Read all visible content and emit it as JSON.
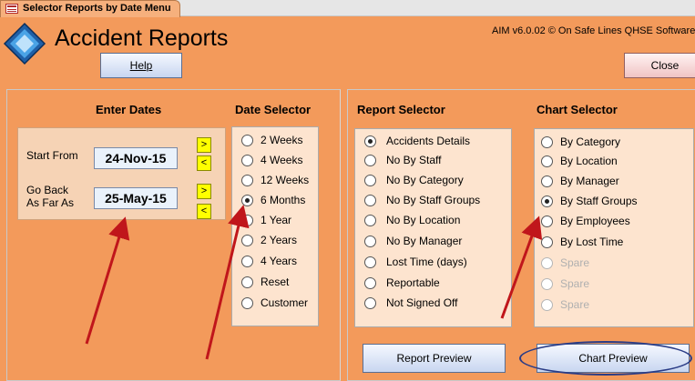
{
  "window": {
    "tab_title": "Selector Reports by Date Menu",
    "icon": "form-icon"
  },
  "header": {
    "title": "Accident Reports",
    "version": "AIM v6.0.02 © On Safe Lines QHSE Software",
    "logo": "diamond-logo"
  },
  "buttons": {
    "help": "Help",
    "close": "Close",
    "report_preview": "Report Preview",
    "chart_preview": "Chart Preview"
  },
  "enter_dates": {
    "heading": "Enter Dates",
    "start_label": "Start From",
    "start_value": "24-Nov-15",
    "back_label_1": "Go Back",
    "back_label_2": "As Far As",
    "back_value": "25-May-15",
    "next_symbol": ">",
    "prev_symbol": "<"
  },
  "date_selector": {
    "heading": "Date Selector",
    "options": [
      "2  Weeks",
      "4  Weeks",
      "12 Weeks",
      "6 Months",
      "1 Year",
      "2 Years",
      "4 Years",
      "Reset",
      "Customer"
    ],
    "selected": "6 Months"
  },
  "report_selector": {
    "heading": "Report Selector",
    "options": [
      "Accidents Details",
      "No By Staff",
      "No By Category",
      "No By Staff Groups",
      "No By Location",
      "No By Manager",
      "Lost Time (days)",
      "Reportable",
      "Not Signed Off"
    ],
    "selected": "Accidents Details"
  },
  "chart_selector": {
    "heading": "Chart Selector",
    "options": [
      "By Category",
      "By Location",
      "By Manager",
      "By Staff Groups",
      "By Employees",
      "By Lost Time",
      "Spare",
      "Spare",
      "Spare"
    ],
    "disabled": [
      false,
      false,
      false,
      false,
      false,
      false,
      true,
      true,
      true
    ],
    "selected": "By Staff Groups"
  },
  "colors": {
    "background": "#f39a5b",
    "list_box": "#fde4cf",
    "arrow_button": "#ffff00",
    "annotation_arrow": "#c0161b",
    "highlight_oval": "#2a3c86"
  }
}
